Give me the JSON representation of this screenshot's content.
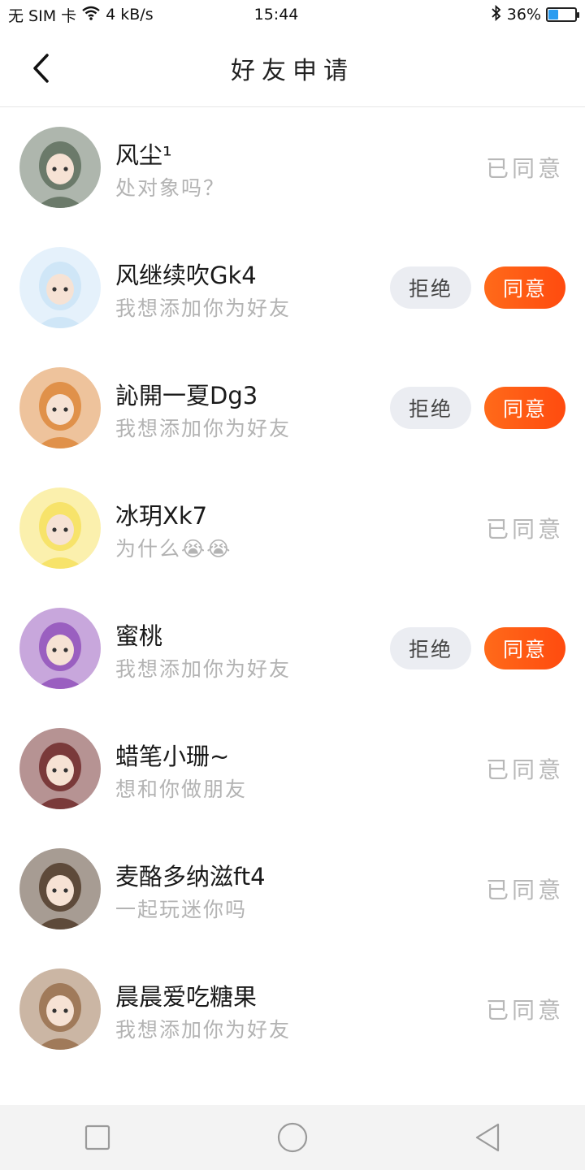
{
  "status_bar": {
    "sim": "无 SIM 卡",
    "speed": "4 kB/s",
    "time": "15:44",
    "battery_text": "36%",
    "battery_level": 0.36
  },
  "header": {
    "title": "好友申请"
  },
  "buttons": {
    "reject": "拒绝",
    "accept": "同意"
  },
  "requests": [
    {
      "name": "风尘¹",
      "message": "处对象吗？",
      "status": "已同意",
      "avatar_color": "#6b7a6a"
    },
    {
      "name": "风继续吹Gk4",
      "message": "我想添加你为好友",
      "status": "pending",
      "avatar_color": "#cfe6f7"
    },
    {
      "name": "訫開一夏Dg3",
      "message": "我想添加你为好友",
      "status": "pending",
      "avatar_color": "#e0914a"
    },
    {
      "name": "冰玥Xk7",
      "message": "为什么😭😭",
      "status": "已同意",
      "avatar_color": "#f7e36a"
    },
    {
      "name": "蜜桃",
      "message": "我想添加你为好友",
      "status": "pending",
      "avatar_color": "#9a5fc0"
    },
    {
      "name": "蜡笔小珊~",
      "message": "想和你做朋友",
      "status": "已同意",
      "avatar_color": "#7a3a3a"
    },
    {
      "name": "麦酪多纳滋ft4",
      "message": "一起玩迷你吗",
      "status": "已同意",
      "avatar_color": "#5e4a3a"
    },
    {
      "name": "晨晨爱吃糖果",
      "message": "我想添加你为好友",
      "status": "已同意",
      "avatar_color": "#a07a5a"
    }
  ]
}
